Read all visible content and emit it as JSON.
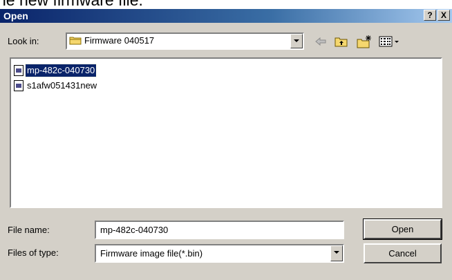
{
  "page_fragment": "ne new firmware file.",
  "dialog": {
    "title": "Open",
    "help_button": "?",
    "close_button": "X",
    "look_in_label": "Look in:",
    "look_in_value": "Firmware 040517",
    "files": [
      {
        "name": "mp-482c-040730",
        "selected": true
      },
      {
        "name": "s1afw051431new",
        "selected": false
      }
    ],
    "file_name_label": "File name:",
    "file_name_value": "mp-482c-040730",
    "files_of_type_label": "Files of type:",
    "files_of_type_value": "Firmware image file(*.bin)",
    "open_button": "Open",
    "cancel_button": "Cancel",
    "toolbar_icons": [
      "back-arrow-icon",
      "up-folder-icon",
      "new-folder-icon",
      "view-menu-icon"
    ]
  }
}
